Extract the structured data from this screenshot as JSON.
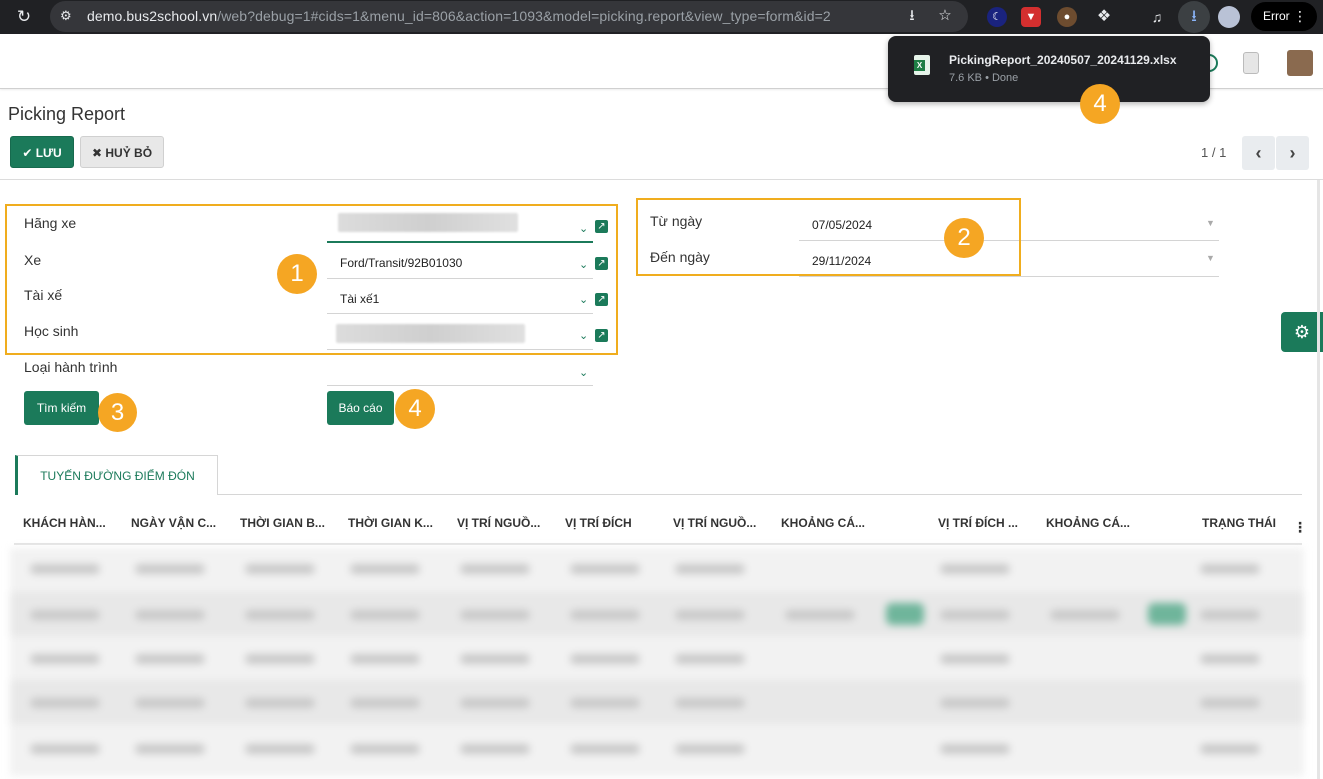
{
  "browser": {
    "url_host": "demo.bus2school.vn",
    "url_path": "/web?debug=1#cids=1&menu_id=806&action=1093&model=picking.report&view_type=form&id=2",
    "error_label": "Error"
  },
  "download": {
    "filename": "PickingReport_20240507_20241129.xlsx",
    "meta": "7.6 KB • Done"
  },
  "page": {
    "title": "Picking Report",
    "save_label": "LƯU",
    "cancel_label": "HUỶ BỎ",
    "pager": "1 / 1"
  },
  "form": {
    "hang_xe_label": "Hãng xe",
    "xe_label": "Xe",
    "xe_value": "Ford/Transit/92B01030",
    "tai_xe_label": "Tài xế",
    "tai_xe_value": "Tài xế1",
    "hoc_sinh_label": "Học sinh",
    "loai_label": "Loại hành trình",
    "tu_ngay_label": "Từ ngày",
    "tu_ngay_value": "07/05/2024",
    "den_ngay_label": "Đến ngày",
    "den_ngay_value": "29/11/2024",
    "search_button": "Tìm kiếm",
    "report_button": "Báo cáo"
  },
  "annotations": [
    "1",
    "2",
    "3",
    "4",
    "4"
  ],
  "notebook": {
    "tab_label": "TUYẾN ĐƯỜNG ĐIỂM ĐÓN",
    "columns": [
      "KHÁCH HÀN...",
      "NGÀY VẬN C...",
      "THỜI GIAN B...",
      "THỜI GIAN K...",
      "VỊ TRÍ NGUỒ...",
      "VỊ TRÍ ĐÍCH",
      "VỊ TRÍ NGUỒ...",
      "KHOẢNG CÁ...",
      "VỊ TRÍ ĐÍCH ...",
      "KHOẢNG CÁ...",
      "TRẠNG THÁI"
    ]
  },
  "colors": {
    "primary": "#1b7a5a",
    "annotation": "#f5a623",
    "annotation_box": "#f0ad1e"
  }
}
